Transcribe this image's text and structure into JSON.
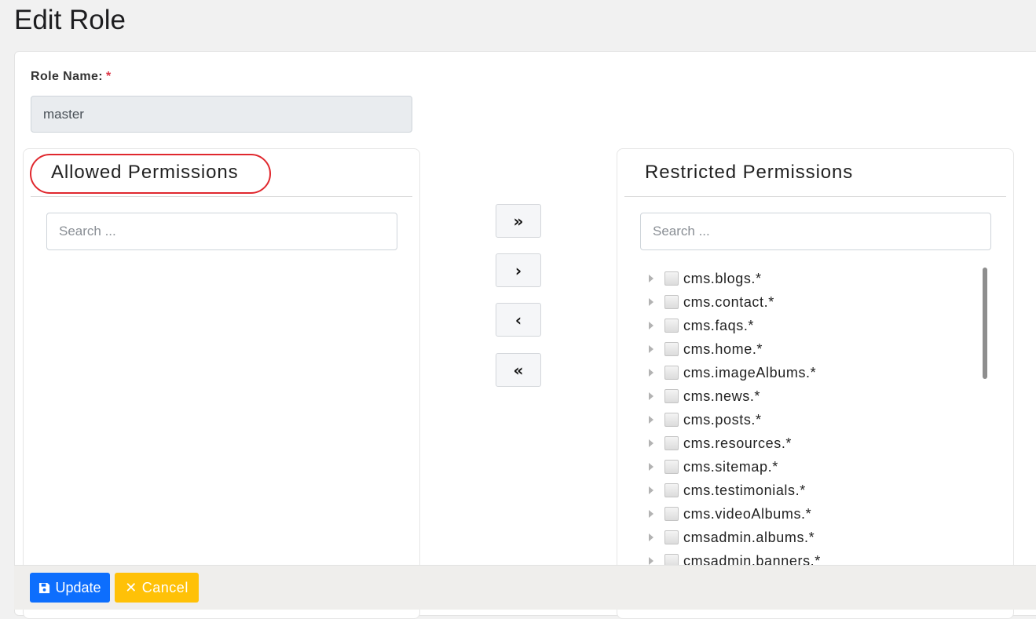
{
  "page": {
    "title": "Edit Role"
  },
  "form": {
    "role_name_label": "Role Name:",
    "required_mark": "*",
    "role_name_value": "master"
  },
  "allowed": {
    "title": "Allowed Permissions",
    "search_placeholder": "Search ...",
    "items": []
  },
  "restricted": {
    "title": "Restricted Permissions",
    "search_placeholder": "Search ...",
    "items": [
      "cms.blogs.*",
      "cms.contact.*",
      "cms.faqs.*",
      "cms.home.*",
      "cms.imageAlbums.*",
      "cms.news.*",
      "cms.posts.*",
      "cms.resources.*",
      "cms.sitemap.*",
      "cms.testimonials.*",
      "cms.videoAlbums.*",
      "cmsadmin.albums.*",
      "cmsadmin.banners.*"
    ]
  },
  "transfer": {
    "move_all_right": "»",
    "move_right": "›",
    "move_left": "‹",
    "move_all_left": "«"
  },
  "actions": {
    "update_label": "Update",
    "cancel_label": "Cancel",
    "update_color": "#0d6efd",
    "cancel_color": "#ffc107"
  }
}
